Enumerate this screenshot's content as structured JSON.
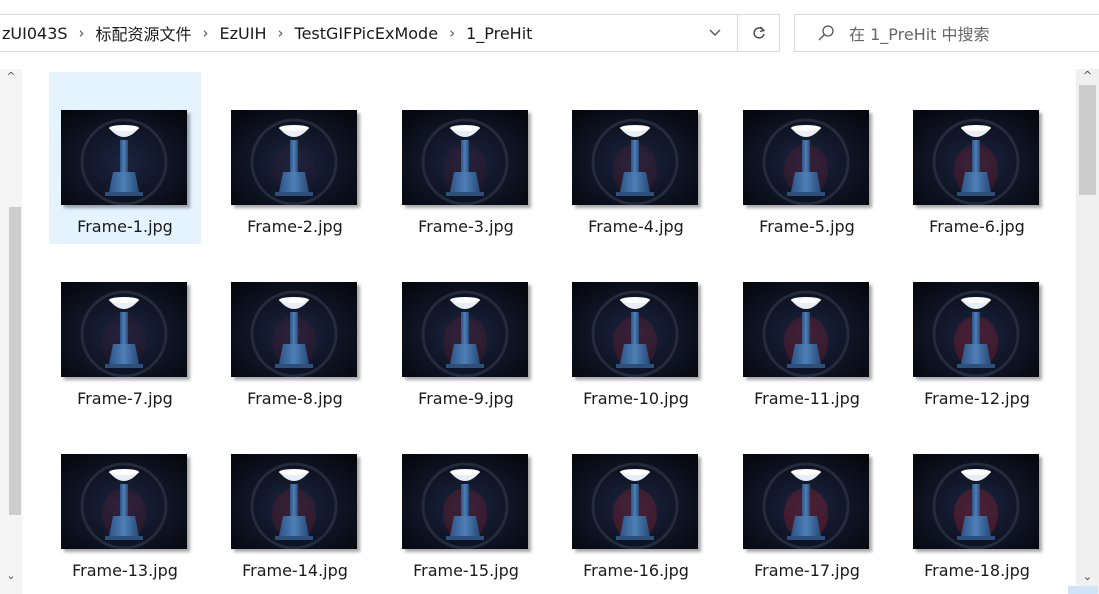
{
  "address_bar": {
    "breadcrumbs": [
      "zUI043S",
      "标配资源文件",
      "EzUIH",
      "TestGIFPicExMode",
      "1_PreHit"
    ],
    "separator": "›",
    "dropdown_icon": "chevron-down-icon",
    "refresh_icon": "refresh-icon"
  },
  "search": {
    "placeholder": "在 1_PreHit 中搜索",
    "icon": "search-icon"
  },
  "files": [
    {
      "name": "Frame-1.jpg",
      "selected": true
    },
    {
      "name": "Frame-2.jpg"
    },
    {
      "name": "Frame-3.jpg"
    },
    {
      "name": "Frame-4.jpg"
    },
    {
      "name": "Frame-5.jpg"
    },
    {
      "name": "Frame-6.jpg"
    },
    {
      "name": "Frame-7.jpg"
    },
    {
      "name": "Frame-8.jpg"
    },
    {
      "name": "Frame-9.jpg"
    },
    {
      "name": "Frame-10.jpg"
    },
    {
      "name": "Frame-11.jpg"
    },
    {
      "name": "Frame-12.jpg"
    },
    {
      "name": "Frame-13.jpg"
    },
    {
      "name": "Frame-14.jpg"
    },
    {
      "name": "Frame-15.jpg"
    },
    {
      "name": "Frame-16.jpg"
    },
    {
      "name": "Frame-17.jpg"
    },
    {
      "name": "Frame-18.jpg"
    }
  ],
  "colors": {
    "selection": "#e5f3ff",
    "thumb_bg": "#05070d",
    "pillar": "#4e7fb6",
    "bowl": "#e8eef5"
  }
}
